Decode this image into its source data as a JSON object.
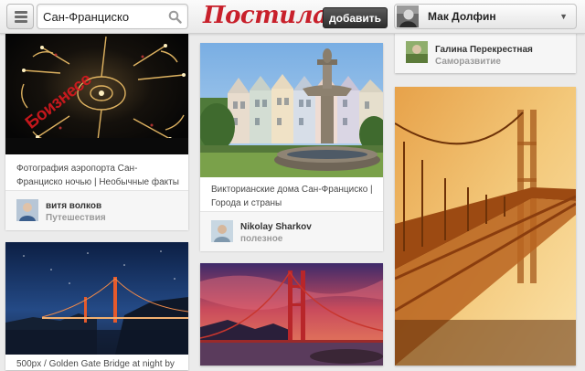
{
  "header": {
    "search_value": "Сан-Франциско",
    "logo": "Постила",
    "add_label": "добавить",
    "user_name": "Мак Долфин"
  },
  "icons": [
    "menu-icon",
    "search-icon",
    "chevron-down-icon"
  ],
  "colors": {
    "brand": "#c8202b",
    "button_dark": "#3a3a3a",
    "background": "#ebebeb"
  },
  "pins": {
    "airport": {
      "description": "Фотография аэропорта Сан-Франциско ночью | Необычные факты",
      "author": "витя волков",
      "board": "Путешествия",
      "stamp": "Боизнесе"
    },
    "victorian": {
      "description": "Викторианские дома Сан-Франциско | Города и страны",
      "author": "Nikolay Sharkov",
      "board": "полезное"
    },
    "galina": {
      "author": "Галина Перекрестная",
      "board": "Саморазвитие"
    },
    "golden_gate_night": {
      "description": "500px / Golden Gate Bridge at night by"
    },
    "golden_gate_sunset": {},
    "bridge_orange": {}
  }
}
